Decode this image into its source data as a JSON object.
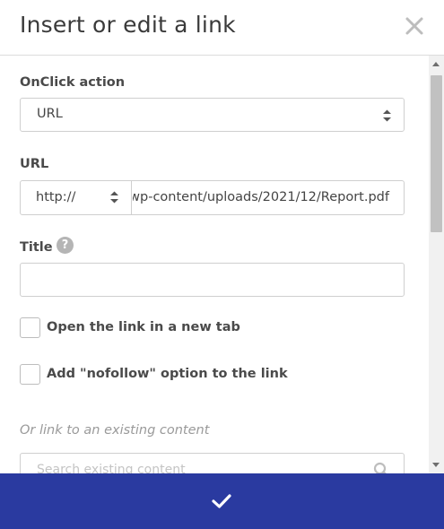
{
  "dialog": {
    "title": "Insert or edit a link",
    "close_icon": "close-icon"
  },
  "form": {
    "onclick_label": "OnClick action",
    "onclick_value": "URL",
    "url_label": "URL",
    "protocol_value": "http://",
    "url_value": "wp-content/uploads/2021/12/Report.pdf",
    "title_label": "Title",
    "title_value": "",
    "help_icon": "help-icon",
    "new_tab_label": "Open the link in a new tab",
    "new_tab_checked": false,
    "nofollow_label": "Add \"nofollow\" option to the link",
    "nofollow_checked": false,
    "existing_label": "Or link to an existing content",
    "search_placeholder": "Search existing content",
    "search_icon": "search-icon"
  },
  "footer": {
    "confirm_icon": "checkmark-icon",
    "accent_color": "#2a3aa0"
  }
}
